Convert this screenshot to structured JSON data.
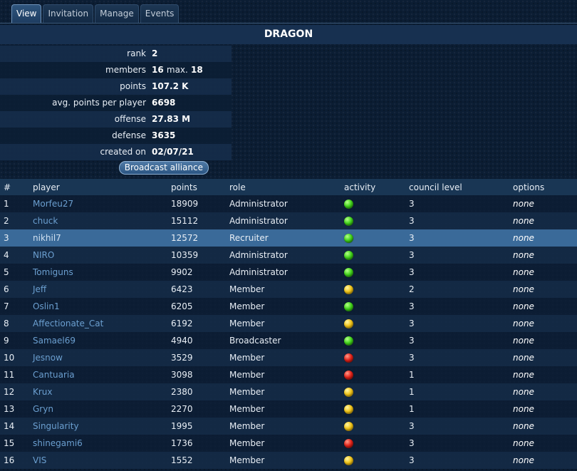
{
  "tabs": [
    "View",
    "Invitation",
    "Manage",
    "Events"
  ],
  "active_tab": "View",
  "alliance_name": "DRAGON",
  "info": {
    "rank": {
      "label": "rank",
      "value": "2"
    },
    "members": {
      "label": "members",
      "value": "16",
      "mid": "max.",
      "max": "18"
    },
    "points": {
      "label": "points",
      "value": "107.2 K"
    },
    "avg_points": {
      "label": "avg. points per player",
      "value": "6698"
    },
    "offense": {
      "label": "offense",
      "value": "27.83 M"
    },
    "defense": {
      "label": "defense",
      "value": "3635"
    },
    "created_on": {
      "label": "created on",
      "value": "02/07/21"
    }
  },
  "broadcast_button": "Broadcast alliance",
  "table": {
    "headers": [
      "#",
      "player",
      "points",
      "role",
      "activity",
      "council level",
      "options"
    ],
    "selected_row": 3,
    "activity_colors": {
      "green": "#42d31b",
      "yellow": "#f0c419",
      "red": "#e2231a"
    },
    "rows": [
      {
        "num": "1",
        "player": "Morfeu27",
        "points": "18909",
        "role": "Administrator",
        "activity": "green",
        "council": "3",
        "options": "none"
      },
      {
        "num": "2",
        "player": "chuck",
        "points": "15112",
        "role": "Administrator",
        "activity": "green",
        "council": "3",
        "options": "none"
      },
      {
        "num": "3",
        "player": "nikhil7",
        "points": "12572",
        "role": "Recruiter",
        "activity": "green",
        "council": "3",
        "options": "none"
      },
      {
        "num": "4",
        "player": "NIRO",
        "points": "10359",
        "role": "Administrator",
        "activity": "green",
        "council": "3",
        "options": "none"
      },
      {
        "num": "5",
        "player": "Tomiguns",
        "points": "9902",
        "role": "Administrator",
        "activity": "green",
        "council": "3",
        "options": "none"
      },
      {
        "num": "6",
        "player": "Jeff",
        "points": "6423",
        "role": "Member",
        "activity": "yellow",
        "council": "2",
        "options": "none"
      },
      {
        "num": "7",
        "player": "Oslin1",
        "points": "6205",
        "role": "Member",
        "activity": "green",
        "council": "3",
        "options": "none"
      },
      {
        "num": "8",
        "player": "Affectionate_Cat",
        "points": "6192",
        "role": "Member",
        "activity": "yellow",
        "council": "3",
        "options": "none"
      },
      {
        "num": "9",
        "player": "Samael69",
        "points": "4940",
        "role": "Broadcaster",
        "activity": "green",
        "council": "3",
        "options": "none"
      },
      {
        "num": "10",
        "player": "Jesnow",
        "points": "3529",
        "role": "Member",
        "activity": "red",
        "council": "3",
        "options": "none"
      },
      {
        "num": "11",
        "player": "Cantuaria",
        "points": "3098",
        "role": "Member",
        "activity": "red",
        "council": "1",
        "options": "none"
      },
      {
        "num": "12",
        "player": "Krux",
        "points": "2380",
        "role": "Member",
        "activity": "yellow",
        "council": "1",
        "options": "none"
      },
      {
        "num": "13",
        "player": "Gryn",
        "points": "2270",
        "role": "Member",
        "activity": "yellow",
        "council": "1",
        "options": "none"
      },
      {
        "num": "14",
        "player": "Singularity",
        "points": "1995",
        "role": "Member",
        "activity": "yellow",
        "council": "3",
        "options": "none"
      },
      {
        "num": "15",
        "player": "shinegami6",
        "points": "1736",
        "role": "Member",
        "activity": "red",
        "council": "3",
        "options": "none"
      },
      {
        "num": "16",
        "player": "VIS",
        "points": "1552",
        "role": "Member",
        "activity": "yellow",
        "council": "3",
        "options": "none"
      }
    ]
  }
}
